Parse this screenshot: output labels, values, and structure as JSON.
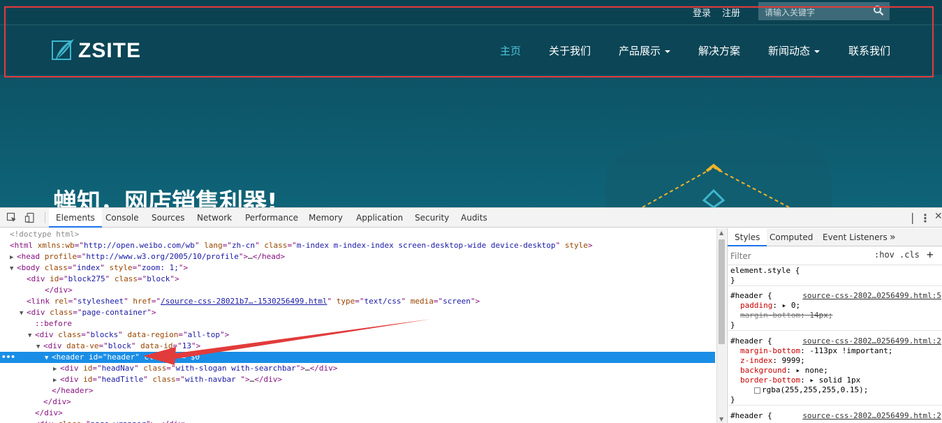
{
  "site": {
    "top_links": [
      "登录",
      "注册"
    ],
    "search_placeholder": "请输入关键字",
    "logo_text": "ZSITE",
    "nav": [
      {
        "label": "主页",
        "active": true,
        "dropdown": false
      },
      {
        "label": "关于我们",
        "active": false,
        "dropdown": false
      },
      {
        "label": "产品展示",
        "active": false,
        "dropdown": true
      },
      {
        "label": "解决方案",
        "active": false,
        "dropdown": false
      },
      {
        "label": "新闻动态",
        "active": false,
        "dropdown": true
      },
      {
        "label": "联系我们",
        "active": false,
        "dropdown": false
      }
    ],
    "hero_title": "蝉知，网店销售利器!",
    "colors": {
      "accent": "#4fc3d9",
      "highlight_box": "#e23b3b",
      "background": "#0d5467"
    }
  },
  "devtools": {
    "tabs": [
      "Elements",
      "Console",
      "Sources",
      "Network",
      "Performance",
      "Memory",
      "Application",
      "Security",
      "Audits"
    ],
    "active_tab": "Elements",
    "dom": {
      "doctype": "<!doctype html>",
      "html_attrs": {
        "xmlns_wb": "http://open.weibo.com/wb",
        "lang": "zh-cn",
        "class": "m-index m-index-index screen-desktop-wide device-desktop",
        "style": "style"
      },
      "head_profile": "http://www.w3.org/2005/10/profile",
      "body_class": "index",
      "body_style": "zoom: 1;",
      "block_id": "block275",
      "block_class": "block",
      "link_rel": "stylesheet",
      "link_href": "/source-css-28021b7…-1530256499.html",
      "link_type": "text/css",
      "link_media": "screen",
      "page_container": "page-container",
      "before": "::before",
      "blocks_class": "blocks",
      "blocks_region": "all-top",
      "block_ve": "block",
      "block_data_id": "13",
      "header_id": "header",
      "header_tail": "class> == $0",
      "headnav_id": "headNav",
      "headnav_class": "with-slogan with-searchbar",
      "headtitle_id": "headTitle",
      "headtitle_class": "with-navbar ",
      "page_wrapper": "page-wrapper"
    },
    "styles_tabs": [
      "Styles",
      "Computed",
      "Event Listeners"
    ],
    "filter_placeholder": "Filter",
    "hov_label": ":hov",
    "cls_label": ".cls",
    "rules": [
      {
        "selector": "element.style {",
        "source": "",
        "props": []
      },
      {
        "selector": "#header {",
        "source": "source-css-2802…0256499.html:5",
        "props": [
          {
            "name": "padding",
            "value": "0;",
            "struck": false,
            "arrow": true
          },
          {
            "name": "margin-bottom",
            "value": "14px;",
            "struck": true,
            "arrow": false
          }
        ]
      },
      {
        "selector": "#header {",
        "source": "source-css-2802…0256499.html:2",
        "props": [
          {
            "name": "margin-bottom",
            "value": "-113px !important;",
            "struck": false,
            "arrow": false
          },
          {
            "name": "z-index",
            "value": "9999;",
            "struck": false,
            "arrow": false
          },
          {
            "name": "background",
            "value": "none;",
            "struck": false,
            "arrow": true
          },
          {
            "name": "border-bottom",
            "value": "solid 1px",
            "struck": false,
            "arrow": true
          }
        ],
        "color_value": "rgba(255,255,255,0.15);"
      },
      {
        "selector": "#header {",
        "source": "source-css-2802…0256499.html:2",
        "props": []
      }
    ]
  }
}
